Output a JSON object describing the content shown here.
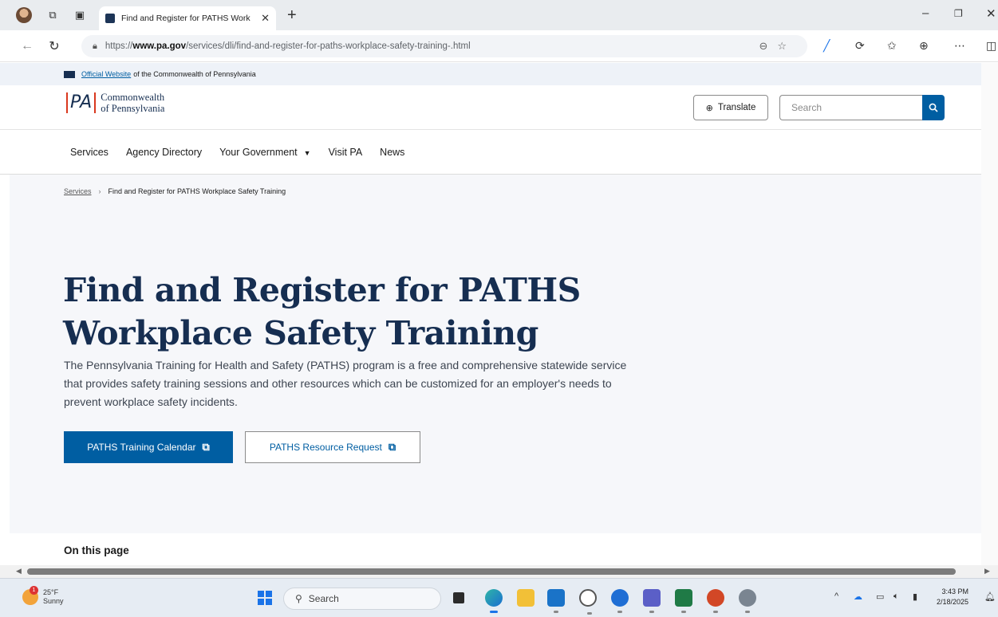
{
  "browser": {
    "tab_title": "Find and Register for PATHS Work",
    "url_prefix": "https://",
    "url_domain": "www.pa.gov",
    "url_path": "/services/dli/find-and-register-for-paths-workplace-safety-training-.html"
  },
  "site": {
    "official_link": "Official Website",
    "official_text": "of the Commonwealth of Pennsylvania",
    "logo_mark": "PA",
    "logo_line1": "Commonwealth",
    "logo_line2": "of Pennsylvania",
    "translate_label": "Translate",
    "search_placeholder": "Search"
  },
  "nav": {
    "items": [
      {
        "label": "Services"
      },
      {
        "label": "Agency Directory"
      },
      {
        "label": "Your Government"
      },
      {
        "label": "Visit PA"
      },
      {
        "label": "News"
      }
    ]
  },
  "breadcrumb": {
    "parent": "Services",
    "current": "Find and Register for PATHS Workplace Safety Training"
  },
  "hero": {
    "title": "Find and Register for PATHS Workplace Safety Training",
    "intro": "The Pennsylvania Training for Health and Safety (PATHS) program is a free and comprehensive statewide service that provides safety training sessions and other resources which can be customized for an employer's needs to prevent workplace safety incidents.",
    "primary_button": "PATHS Training Calendar",
    "secondary_button": "PATHS Resource Request"
  },
  "on_this_page": "On this page",
  "taskbar": {
    "temp": "25°F",
    "condition": "Sunny",
    "search_label": "Search",
    "time": "3:43 PM",
    "date": "2/18/2025"
  },
  "colors": {
    "primary_blue": "#005ea2",
    "navy": "#162e51",
    "hero_bg": "#f6f7fa"
  }
}
